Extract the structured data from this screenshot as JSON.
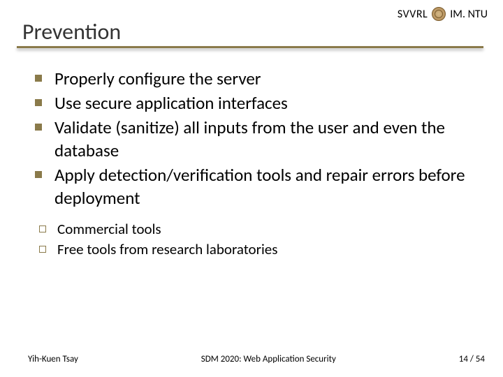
{
  "header": {
    "org_left": "SVVRL",
    "org_right": "IM. NTU",
    "title": "Prevention"
  },
  "bullets": [
    "Properly  configure the server",
    "Use secure application interfaces",
    "Validate (sanitize) all inputs from the user and even the database",
    "Apply detection/verification tools and repair errors before deployment"
  ],
  "sub_bullets": [
    "Commercial tools",
    "Free tools from research laboratories"
  ],
  "footer": {
    "author": "Yih-Kuen Tsay",
    "course": "SDM 2020: Web Application Security",
    "page": "14 / 54"
  }
}
